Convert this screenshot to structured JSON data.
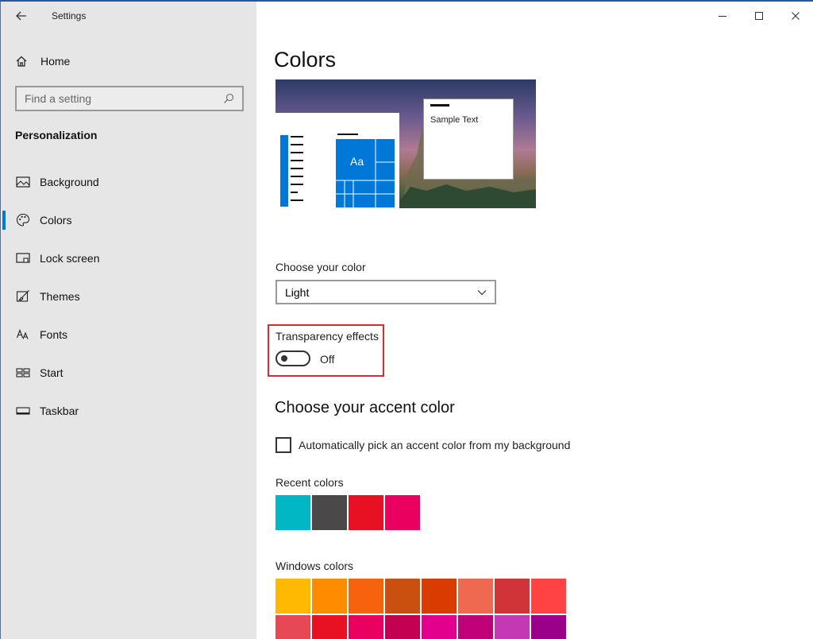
{
  "window": {
    "title": "Settings"
  },
  "sidebar": {
    "home_label": "Home",
    "search_placeholder": "Find a setting",
    "section_title": "Personalization",
    "items": [
      {
        "label": "Background",
        "icon": "picture-icon",
        "active": false
      },
      {
        "label": "Colors",
        "icon": "palette-icon",
        "active": true
      },
      {
        "label": "Lock screen",
        "icon": "lock-screen-icon",
        "active": false
      },
      {
        "label": "Themes",
        "icon": "brush-icon",
        "active": false
      },
      {
        "label": "Fonts",
        "icon": "font-icon",
        "active": false
      },
      {
        "label": "Start",
        "icon": "start-icon",
        "active": false
      },
      {
        "label": "Taskbar",
        "icon": "taskbar-icon",
        "active": false
      }
    ]
  },
  "main": {
    "title": "Colors",
    "preview": {
      "sample_text": "Sample Text",
      "tile_text": "Aa",
      "accent": "#0078d7"
    },
    "choose_color": {
      "label": "Choose your color",
      "value": "Light"
    },
    "transparency": {
      "label": "Transparency effects",
      "state": "Off",
      "highlight": "#e0282e"
    },
    "accent_heading": "Choose your accent color",
    "auto_pick": {
      "label": "Automatically pick an accent color from my background",
      "checked": false
    },
    "recent_colors": {
      "label": "Recent colors",
      "colors": [
        "#00b7c3",
        "#4a4848",
        "#e81123",
        "#ea005e"
      ]
    },
    "windows_colors": {
      "label": "Windows colors",
      "row1": [
        "#ffb900",
        "#ff8c00",
        "#f7630c",
        "#ca5010",
        "#da3b01",
        "#ef6950",
        "#d13438",
        "#ff4343"
      ],
      "row2": [
        "#e74856",
        "#e81123",
        "#ea005e",
        "#c30052",
        "#e3008c",
        "#bf0077",
        "#c239b3",
        "#9a0089"
      ]
    }
  }
}
